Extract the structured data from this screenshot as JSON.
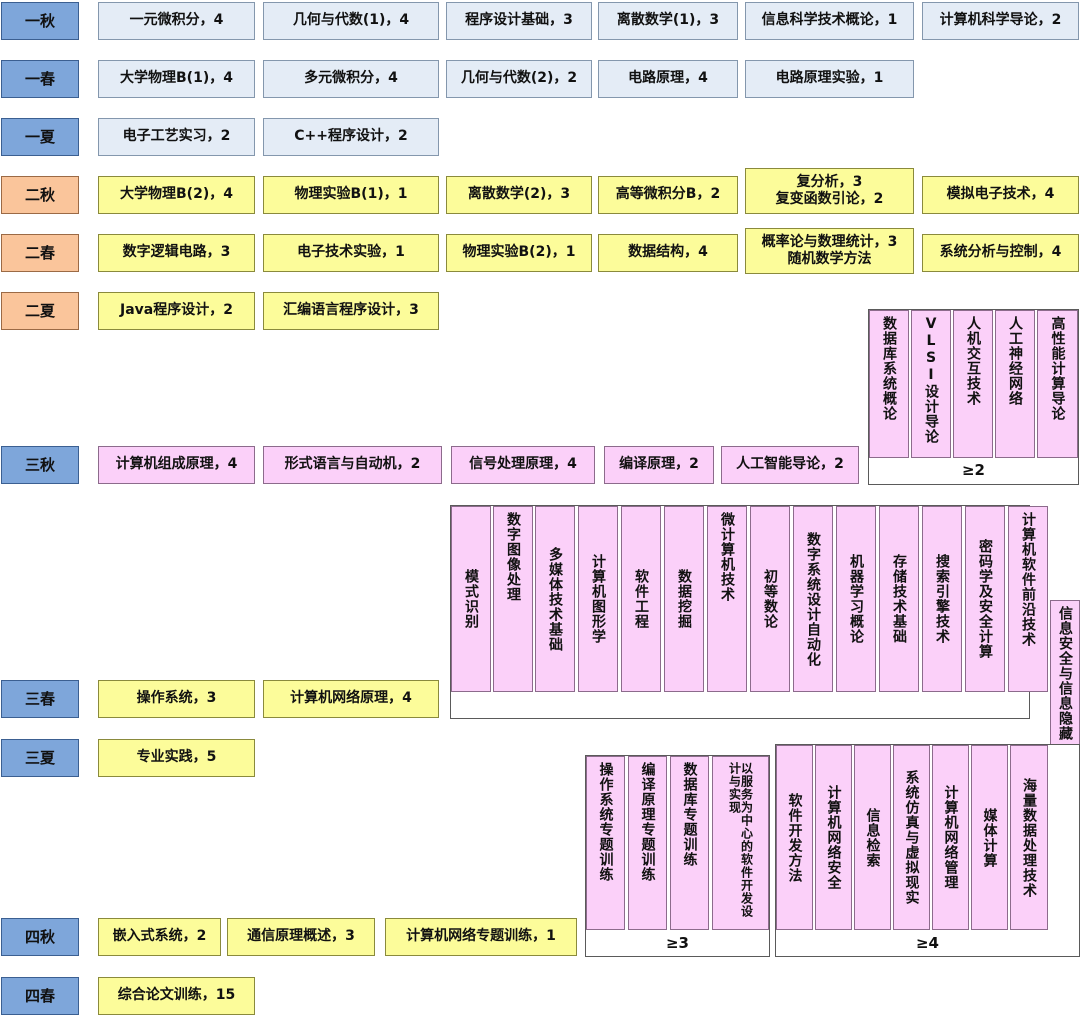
{
  "terms": [
    {
      "label": "一秋",
      "season": "blue"
    },
    {
      "label": "一春",
      "season": "blue"
    },
    {
      "label": "一夏",
      "season": "blue"
    },
    {
      "label": "二秋",
      "season": "orange"
    },
    {
      "label": "二春",
      "season": "orange"
    },
    {
      "label": "二夏",
      "season": "orange"
    },
    {
      "label": "三秋",
      "season": "blue"
    },
    {
      "label": "三春",
      "season": "blue"
    },
    {
      "label": "三夏",
      "season": "blue"
    },
    {
      "label": "四秋",
      "season": "blue"
    },
    {
      "label": "四春",
      "season": "blue"
    }
  ],
  "courses": {
    "y1_fall": [
      "一元微积分，4",
      "几何与代数(1)，4",
      "程序设计基础，3",
      "离散数学(1)，3",
      "信息科学技术概论，1",
      "计算机科学导论，2"
    ],
    "y1_spring": [
      "大学物理B(1)，4",
      "多元微积分，4",
      "几何与代数(2)，2",
      "电路原理，4",
      "电路原理实验，1"
    ],
    "y1_summer": [
      "电子工艺实习，2",
      "C++程序设计，2"
    ],
    "y2_fall": [
      "大学物理B(2)，4",
      "物理实验B(1)，1",
      "离散数学(2)，3",
      "高等微积分B，2"
    ],
    "y2_fall_double": [
      "复分析，3",
      "复变函数引论，2"
    ],
    "y2_fall_last": "模拟电子技术，4",
    "y2_spring": [
      "数字逻辑电路，3",
      "电子技术实验，1",
      "物理实验B(2)，1",
      "数据结构，4"
    ],
    "y2_spring_double": [
      "概率论与数理统计，3",
      "随机数学方法"
    ],
    "y2_spring_last": "系统分析与控制，4",
    "y2_summer": [
      "Java程序设计，2",
      "汇编语言程序设计，3"
    ],
    "y3_fall": [
      "计算机组成原理，4",
      "形式语言与自动机，2",
      "信号处理原理，4",
      "编译原理，2",
      "人工智能导论，2"
    ],
    "y3_spring": [
      "操作系统，3",
      "计算机网络原理，4"
    ],
    "y3_summer": [
      "专业实践，5"
    ],
    "y4_fall": [
      "嵌入式系统，2",
      "通信原理概述，3",
      "计算机网络专题训练，1"
    ],
    "y4_spring": [
      "综合论文训练，15"
    ]
  },
  "elective_groups": {
    "g1": {
      "items": [
        "数据库系统概论",
        "VLSI设计导论",
        "人机交互技术",
        "人工神经网络",
        "高性能计算导论"
      ],
      "requirement": "≥2"
    },
    "g2": {
      "items": [
        "模式识别",
        "数字图像处理",
        "多媒体技术基础",
        "计算机图形学",
        "软件工程",
        "数据挖掘",
        "微计算机技术",
        "初等数论",
        "数字系统设计自动化",
        "机器学习概论",
        "存储技术基础",
        "搜索引擎技术",
        "密码学及安全计算",
        "计算机软件前沿技术",
        "信息安全与信息隐藏"
      ]
    },
    "g3": {
      "items": [
        "操作系统专题训练",
        "编译原理专题训练",
        "数据库专题训练",
        "以服务为中心的软件开发设计与实现"
      ],
      "requirement": "≥3"
    },
    "g4": {
      "items": [
        "软件开发方法",
        "计算机网络安全",
        "信息检索",
        "系统仿真与虚拟现实",
        "计算机网络管理",
        "媒体计算",
        "海量数据处理技术"
      ],
      "requirement": "≥4"
    }
  },
  "colors": {
    "term_blue": "#7ea6da",
    "term_orange": "#fac59b",
    "required_blue": "#e4ecf6",
    "required_yellow": "#fcfc9a",
    "elective_pink": "#fbd0f9"
  }
}
